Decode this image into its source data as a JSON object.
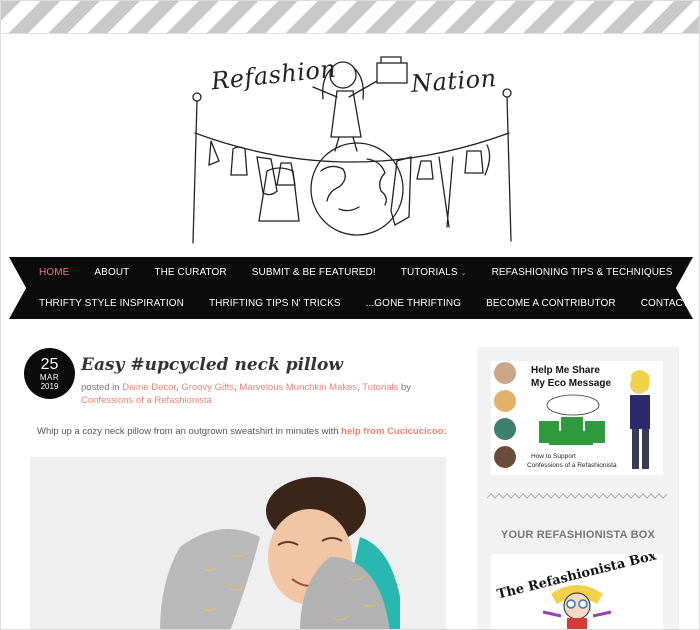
{
  "site": {
    "logo_word_1": "Refashion",
    "logo_word_2": "Nation"
  },
  "nav": {
    "row1": [
      {
        "label": "HOME",
        "active": true
      },
      {
        "label": "ABOUT"
      },
      {
        "label": "THE CURATOR"
      },
      {
        "label": "SUBMIT & BE FEATURED!"
      },
      {
        "label": "TUTORIALS",
        "has_dropdown": true
      },
      {
        "label": "REFASHIONING TIPS & TECHNIQUES"
      }
    ],
    "row2": [
      {
        "label": "THRIFTY STYLE INSPIRATION"
      },
      {
        "label": "THRIFTING TIPS N' TRICKS"
      },
      {
        "label": "...GONE THRIFTING"
      },
      {
        "label": "BECOME A CONTRIBUTOR"
      },
      {
        "label": "CONTACT"
      }
    ],
    "dropdown_glyph": "⌄"
  },
  "post": {
    "date": {
      "day": "25",
      "month": "MAR",
      "year": "2019"
    },
    "title": "Easy #upcycled neck pillow",
    "meta": {
      "prefix": "posted in ",
      "categories": [
        "Divine Decor",
        "Groovy Gifts",
        "Marvelous Munchkin Makes",
        "Tutorials"
      ],
      "by": " by ",
      "author": "Confessions of a Refashionista"
    },
    "intro_text": "Whip up a cozy neck pillow from an outgrown sweatshirt in minutes with ",
    "intro_link": "help from Cucicucicoo:"
  },
  "sidebar": {
    "eco": {
      "line1": "Help Me Share",
      "line2": "My Eco Message",
      "caption1": "How to Support",
      "caption2": "Confessions of a Refashionista"
    },
    "box_heading": "YOUR REFASHIONISTA BOX",
    "box_title": "The Refashionista Box"
  },
  "colors": {
    "accent": "#f07b6f",
    "link": "#e9837a",
    "nav_bg": "#0b0b0b",
    "sidebar_bg": "#f2f2f2"
  }
}
